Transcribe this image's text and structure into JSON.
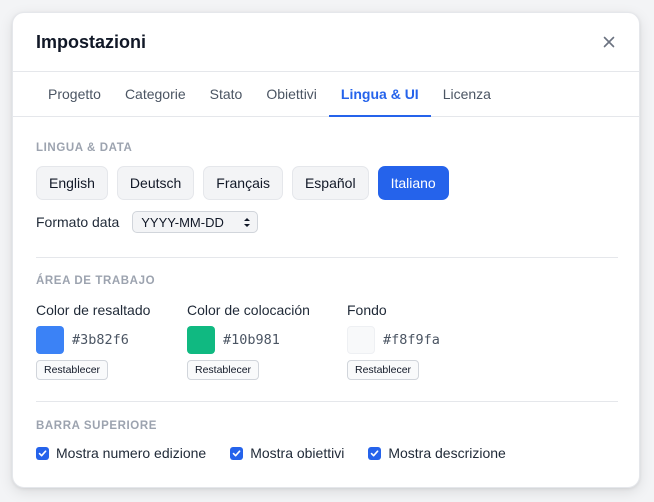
{
  "dialog": {
    "title": "Impostazioni"
  },
  "tabs": [
    {
      "label": "Progetto",
      "active": false
    },
    {
      "label": "Categorie",
      "active": false
    },
    {
      "label": "Stato",
      "active": false
    },
    {
      "label": "Obiettivi",
      "active": false
    },
    {
      "label": "Lingua & UI",
      "active": true
    },
    {
      "label": "Licenza",
      "active": false
    }
  ],
  "language_section": {
    "title": "Lingua & Data",
    "languages": [
      {
        "label": "English",
        "active": false
      },
      {
        "label": "Deutsch",
        "active": false
      },
      {
        "label": "Français",
        "active": false
      },
      {
        "label": "Español",
        "active": false
      },
      {
        "label": "Italiano",
        "active": true
      }
    ],
    "date_format_label": "Formato data",
    "date_format_value": "YYYY-MM-DD"
  },
  "workspace_section": {
    "title": "Área de trabajo",
    "colors": [
      {
        "label": "Color de resaltado",
        "hex": "#3b82f6",
        "reset_label": "Restablecer"
      },
      {
        "label": "Color de colocación",
        "hex": "#10b981",
        "reset_label": "Restablecer"
      },
      {
        "label": "Fondo",
        "hex": "#f8f9fa",
        "reset_label": "Restablecer"
      }
    ]
  },
  "topbar_section": {
    "title": "Barra superiore",
    "options": [
      {
        "label": "Mostra numero edizione",
        "checked": true
      },
      {
        "label": "Mostra obiettivi",
        "checked": true
      },
      {
        "label": "Mostra descrizione",
        "checked": true
      }
    ]
  },
  "theme": {
    "accent": "#2563eb"
  }
}
